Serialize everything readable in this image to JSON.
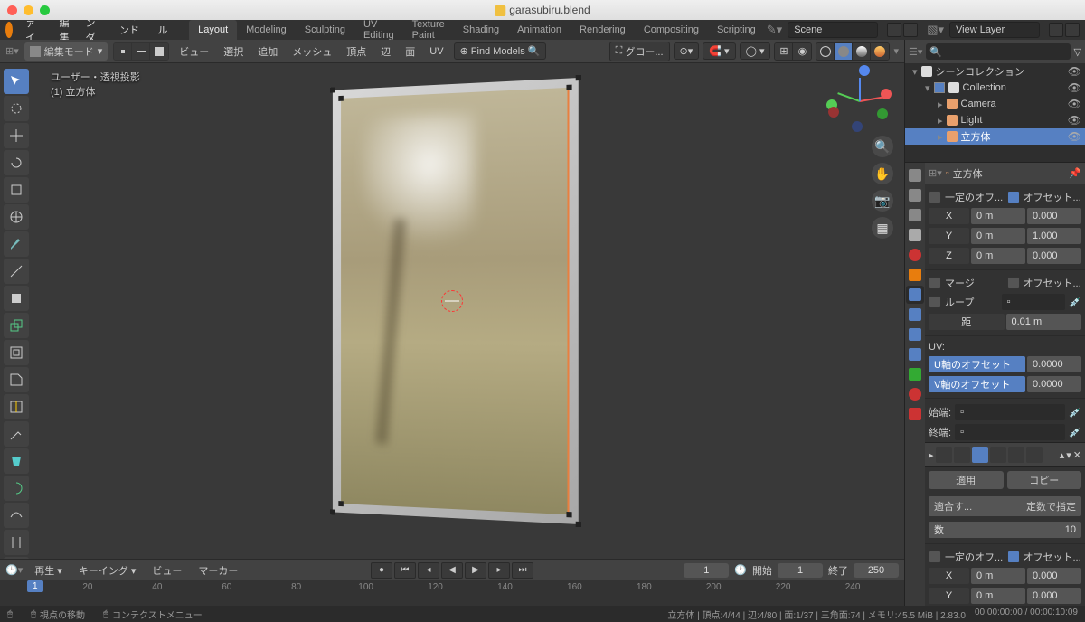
{
  "window": {
    "title": "garasubiru.blend"
  },
  "menubar": {
    "items": [
      "ファイル",
      "編集",
      "レンダー",
      "ウィンドウ",
      "ヘルプ"
    ],
    "workspaces": [
      "Layout",
      "Modeling",
      "Sculpting",
      "UV Editing",
      "Texture Paint",
      "Shading",
      "Animation",
      "Rendering",
      "Compositing",
      "Scripting"
    ],
    "active_workspace": 0,
    "scene_label": "Scene",
    "viewlayer_label": "View Layer"
  },
  "viewport": {
    "mode": "編集モード",
    "header_menus": [
      "ビュー",
      "選択",
      "追加",
      "メッシュ",
      "頂点",
      "辺",
      "面",
      "UV"
    ],
    "find_models": "Find Models",
    "global": "グロー...",
    "snap": "",
    "overlay_title": "ユーザー・透視投影",
    "overlay_object": "(1) 立方体"
  },
  "timeline": {
    "menus": [
      "再生 ▾",
      "キーイング ▾",
      "ビュー",
      "マーカー"
    ],
    "start_label": "開始",
    "start": 1,
    "end_label": "終了",
    "end": 250,
    "current": 1,
    "ticks": [
      20,
      40,
      60,
      80,
      100,
      120,
      140,
      160,
      180,
      200,
      220,
      240
    ]
  },
  "statusbar": {
    "left1": "視点の移動",
    "left2": "コンテクストメニュー",
    "right": "立方体 | 頂点:4/44 | 辺:4/80 | 面:1/37 | 三角面:74 | メモリ:45.5 MiB | 2.83.0",
    "time": "00:00:00:00 / 00:00:10:09"
  },
  "outliner": {
    "search_placeholder": "",
    "rows": [
      {
        "indent": 0,
        "label": "シーンコレクション",
        "expanded": true,
        "sel": false,
        "color": "#ddd"
      },
      {
        "indent": 1,
        "label": "Collection",
        "expanded": true,
        "sel": false,
        "color": "#ddd",
        "check": true
      },
      {
        "indent": 2,
        "label": "Camera",
        "expanded": false,
        "sel": false,
        "color": "#e9a06c"
      },
      {
        "indent": 2,
        "label": "Light",
        "expanded": false,
        "sel": false,
        "color": "#e9a06c"
      },
      {
        "indent": 2,
        "label": "立方体",
        "expanded": false,
        "sel": true,
        "color": "#e9a06c"
      }
    ]
  },
  "properties": {
    "header_path": "立方体",
    "panel1": {
      "checkA_label": "一定のオフ...",
      "checkB_label": "オフセット...",
      "rows": [
        {
          "axis": "X",
          "r": "0 m",
          "v": "0.000"
        },
        {
          "axis": "Y",
          "r": "0 m",
          "v": "1.000"
        },
        {
          "axis": "Z",
          "r": "0 m",
          "v": "0.000"
        }
      ]
    },
    "panel2": {
      "merge": "マージ",
      "offset": "オフセット...",
      "loop": "ループ",
      "dist_label": "距",
      "dist": "0.01 m"
    },
    "uv": {
      "title": "UV:",
      "u_label": "U軸のオフセット",
      "u_val": "0.0000",
      "v_label": "V軸のオフセット",
      "v_val": "0.0000"
    },
    "caps": {
      "start": "始端:",
      "end": "終端:"
    },
    "buttons": {
      "apply": "適用",
      "copy": "コピー"
    },
    "fit": {
      "label": "適合す...",
      "mode": "定数で指定",
      "count_label": "数",
      "count": 10
    },
    "panel3": {
      "checkA_label": "一定のオフ...",
      "checkB_label": "オフセット...",
      "rows": [
        {
          "axis": "X",
          "r": "0 m",
          "v": "0.000"
        },
        {
          "axis": "Y",
          "r": "0 m",
          "v": "0.000"
        }
      ]
    }
  }
}
